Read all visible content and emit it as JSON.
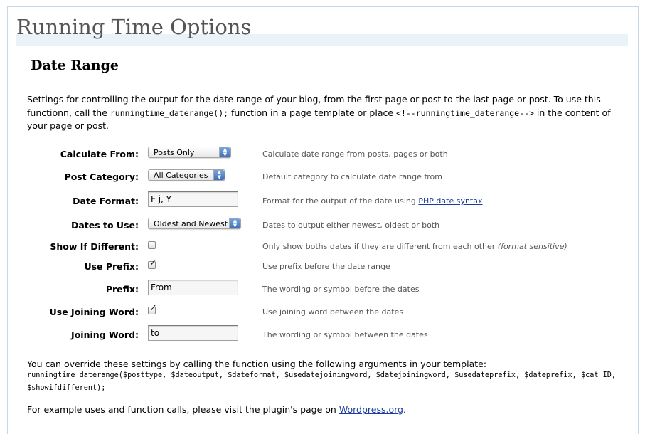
{
  "page": {
    "title": "Running Time Options",
    "section_title": "Date Range"
  },
  "intro": {
    "text_1": "Settings for controlling the output for the date range of your blog, from the first page or post to the last page or post. To use this functionn, call the ",
    "code_1": "runningtime_daterange();",
    "text_2": " function in a page template or place ",
    "code_2": "<!--runningtime_daterange-->",
    "text_3": " in the content of your page or post."
  },
  "fields": {
    "calculate_from": {
      "label": "Calculate From:",
      "value": "Posts Only",
      "description": "Calculate date range from posts, pages or both"
    },
    "post_category": {
      "label": "Post Category:",
      "value": "All Categories",
      "description": "Default category to calculate date range from"
    },
    "date_format": {
      "label": "Date Format:",
      "value": "F j, Y",
      "description": "Format for the output of the date using ",
      "link": "PHP date syntax"
    },
    "dates_to_use": {
      "label": "Dates to Use:",
      "value": "Oldest and Newest",
      "description": "Dates to output either newest, oldest or both"
    },
    "show_if_different": {
      "label": "Show If Different:",
      "checked": false,
      "description": "Only show boths dates if they are different from each other ",
      "note": "(format sensitive)"
    },
    "use_prefix": {
      "label": "Use Prefix:",
      "checked": true,
      "description": "Use prefix before the date range"
    },
    "prefix": {
      "label": "Prefix:",
      "value": "From",
      "description": "The wording or symbol before the dates"
    },
    "use_joining_word": {
      "label": "Use Joining Word:",
      "checked": true,
      "description": "Use joining word between the dates"
    },
    "joining_word": {
      "label": "Joining Word:",
      "value": "to",
      "description": "The wording or symbol between the dates"
    }
  },
  "footer": {
    "override_text": "You can override these settings by calling the function using the following arguments in your template:",
    "code": "runningtime_daterange($posttype, $dateoutput, $dateformat, $usedatejoiningword, $datejoiningword, $usedateprefix, $dateprefix, $cat_ID, $showifdifferent);",
    "example_text": "For example uses and function calls, please visit the plugin's page on ",
    "example_link": "Wordpress.org",
    "example_end": "."
  },
  "icons": {
    "select_arrows": "up-down-arrows-icon",
    "checkbox_tick": "checkmark-icon"
  },
  "colors": {
    "title_band": "#eaf3fa",
    "link": "#1a3c9c",
    "description": "#555555"
  }
}
